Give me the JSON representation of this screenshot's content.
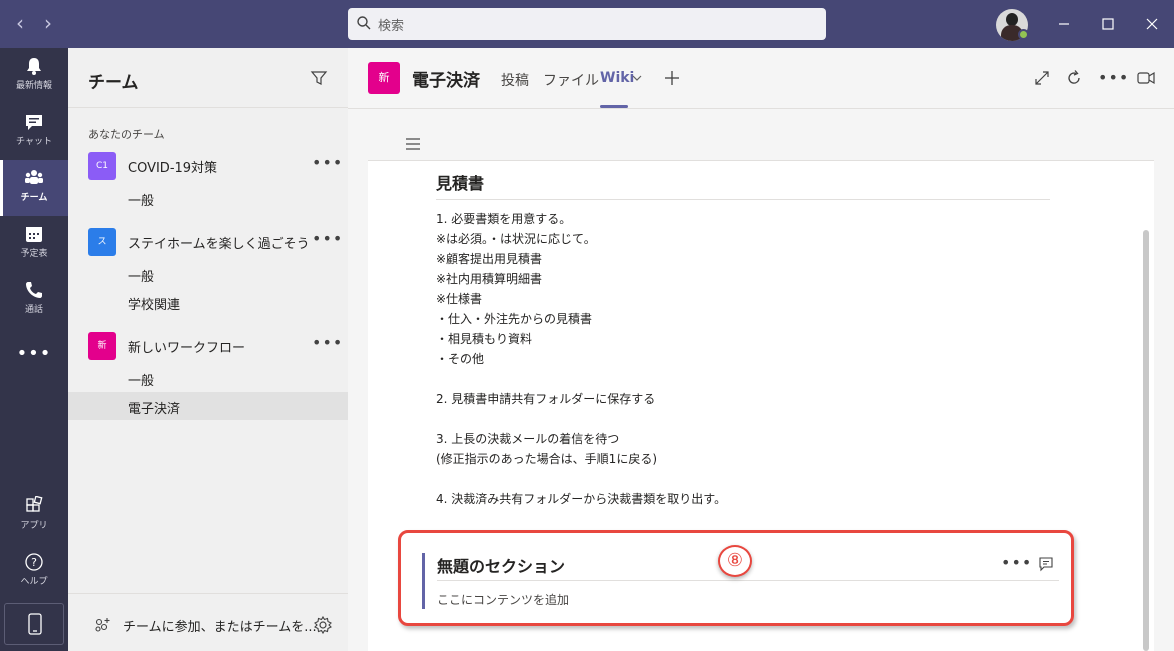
{
  "titlebar": {
    "search_placeholder": "検索"
  },
  "rail": {
    "items": [
      {
        "label": "最新情報",
        "icon": "bell-icon"
      },
      {
        "label": "チャット",
        "icon": "chat-icon"
      },
      {
        "label": "チーム",
        "icon": "teams-icon",
        "active": true
      },
      {
        "label": "予定表",
        "icon": "calendar-icon"
      },
      {
        "label": "通話",
        "icon": "phone-icon"
      },
      {
        "label": "アプリ",
        "icon": "apps-icon"
      },
      {
        "label": "ヘルプ",
        "icon": "help-icon"
      }
    ]
  },
  "teams_panel": {
    "title": "チーム",
    "section_label": "あなたのチーム",
    "teams": [
      {
        "initials": "C1",
        "color": "#8b5cf6",
        "name": "COVID-19対策",
        "channels": [
          "一般"
        ]
      },
      {
        "initials": "ス",
        "color": "#2b7de9",
        "name": "ステイホームを楽しく過ごそう",
        "channels": [
          "一般",
          "学校関連"
        ]
      },
      {
        "initials": "新",
        "color": "#e3008c",
        "name": "新しいワークフロー",
        "channels": [
          "一般",
          "電子決済"
        ]
      }
    ],
    "footer_text": "チームに参加、またはチームを..."
  },
  "channel_header": {
    "avatar": "新",
    "title": "電子決済",
    "tabs": [
      "投稿",
      "ファイル",
      "Wiki"
    ],
    "active_tab": "Wiki"
  },
  "wiki": {
    "heading": "見積書",
    "lines": [
      "1.  必要書類を用意する。",
      "     ※は必須。・は状況に応じて。",
      "※顧客提出用見積書",
      "※社内用積算明細書",
      "※仕様書",
      "・仕入・外注先からの見積書",
      "・相見積もり資料",
      "・その他",
      "2.  見積書申請共有フォルダーに保存する",
      "3.  上長の決裁メールの着信を待つ",
      "     (修正指示のあった場合は、手順1に戻る)",
      "4.  決裁済み共有フォルダーから決裁書類を取り出す。"
    ],
    "new_section_title": "無題のセクション",
    "new_section_placeholder": "ここにコンテンツを追加"
  },
  "annotation": {
    "step_marker": "⑧",
    "highlight_color": "#e8473f"
  },
  "colors": {
    "titlebar": "#464775",
    "rail": "#33344a",
    "accent": "#6264a7"
  }
}
